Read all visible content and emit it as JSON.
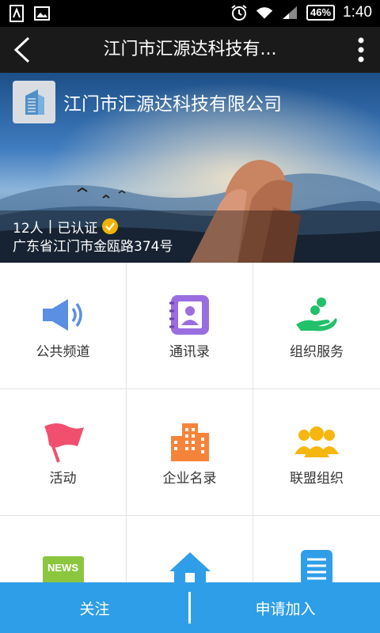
{
  "status_bar": {
    "battery": "46%",
    "time": "1:40"
  },
  "app_bar": {
    "title": "江门市汇源达科技有..."
  },
  "banner": {
    "company_name": "江门市汇源达科技有限公司",
    "members": "12人",
    "divider": "|",
    "certified": "已认证",
    "address": "广东省江门市金瓯路374号"
  },
  "grid": {
    "items": [
      {
        "label": "公共频道",
        "icon": "megaphone-icon",
        "color": "#5b8fe3"
      },
      {
        "label": "通讯录",
        "icon": "contacts-book-icon",
        "color": "#9a6ee0"
      },
      {
        "label": "组织服务",
        "icon": "hand-coin-icon",
        "color": "#22c06a"
      },
      {
        "label": "活动",
        "icon": "flag-icon",
        "color": "#f0506e"
      },
      {
        "label": "企业名录",
        "icon": "building-icon",
        "color": "#f5843a"
      },
      {
        "label": "联盟组织",
        "icon": "group-icon",
        "color": "#f5b70f"
      },
      {
        "label": "",
        "icon": "news-icon",
        "color": "#8cc63f",
        "badge": "NEWS"
      },
      {
        "label": "",
        "icon": "home-icon",
        "color": "#2f9ee8"
      },
      {
        "label": "",
        "icon": "document-icon",
        "color": "#2f9ee8"
      }
    ]
  },
  "bottom_bar": {
    "follow_label": "关注",
    "join_label": "申请加入",
    "color": "#2f9ee8"
  }
}
